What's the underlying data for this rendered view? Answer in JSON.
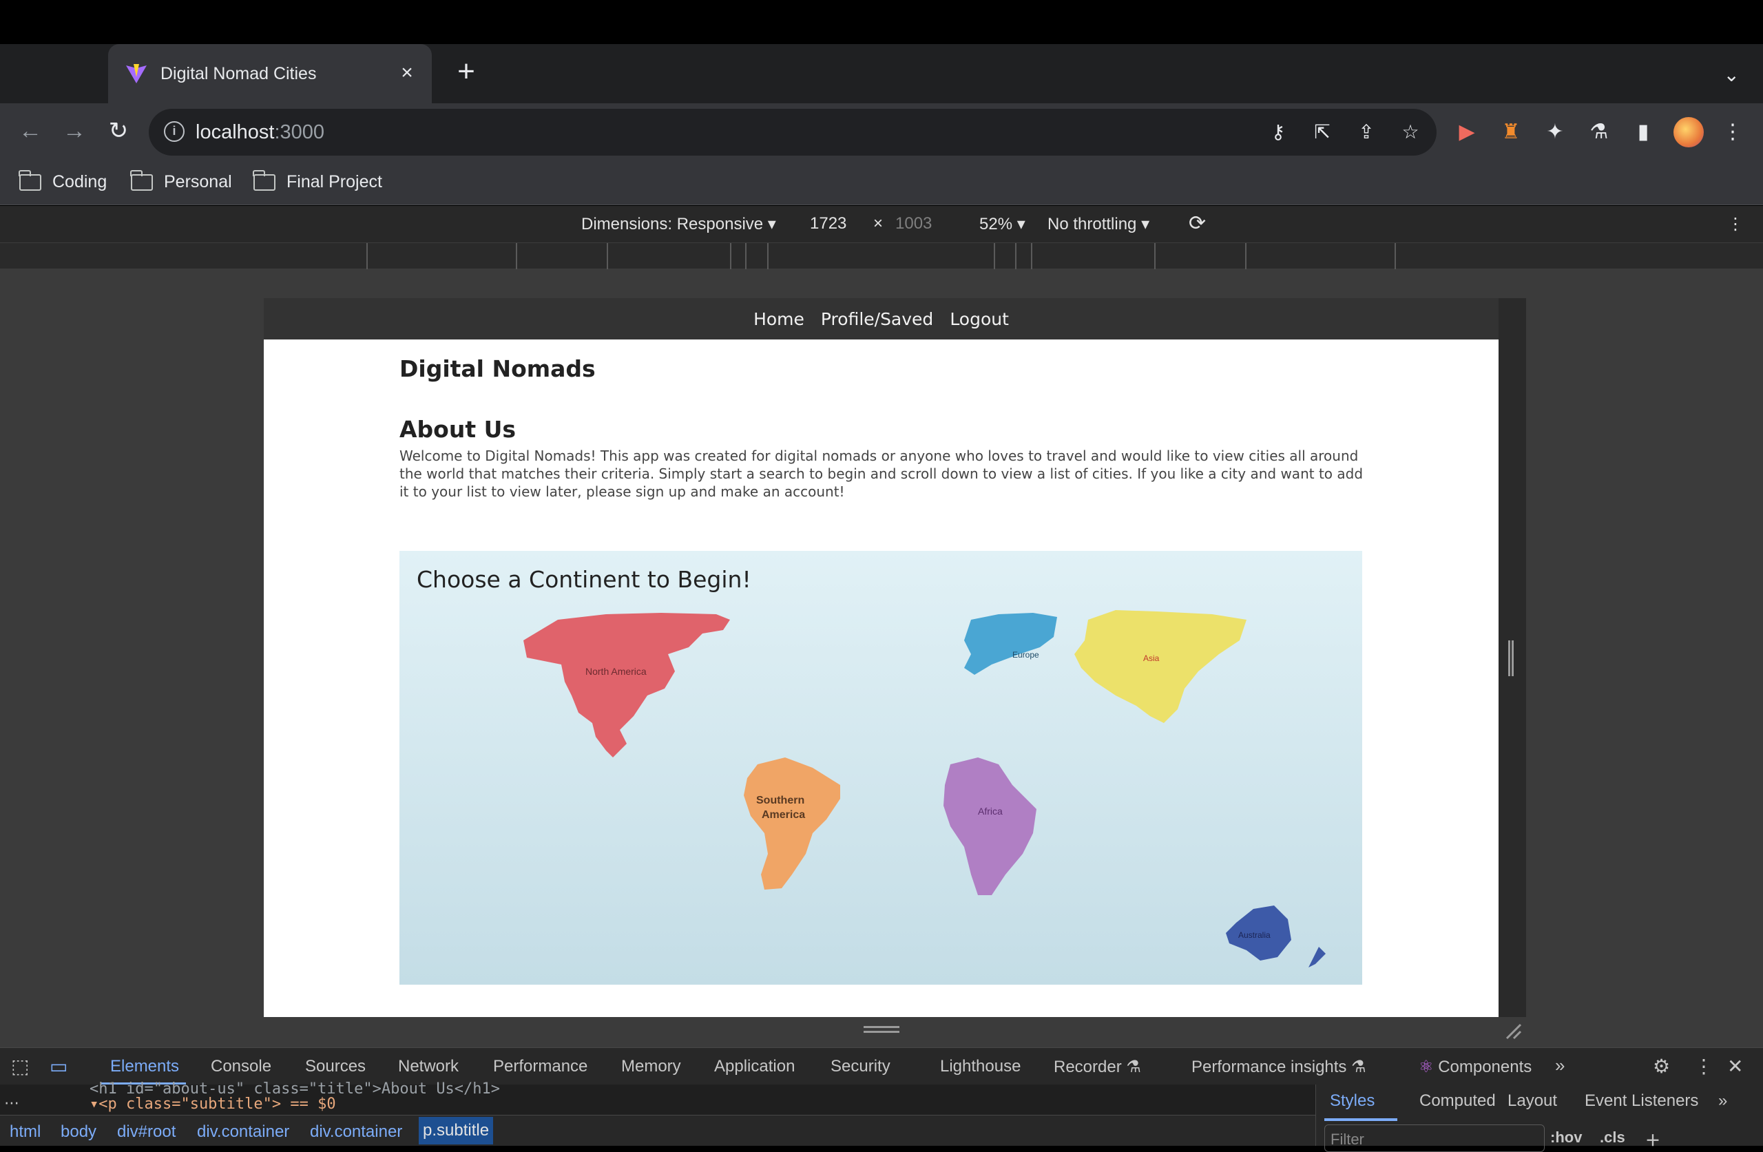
{
  "browser": {
    "tab_title": "Digital Nomad Cities",
    "tab_close": "×",
    "new_tab": "+",
    "url_host": "localhost",
    "url_port": ":3000",
    "bookmarks": [
      "Coding",
      "Personal",
      "Final Project"
    ]
  },
  "device_toolbar": {
    "dimensions_label": "Dimensions: Responsive ▾",
    "width": "1723",
    "times": "×",
    "height": "1003",
    "zoom": "52% ▾",
    "throttling": "No throttling ▾"
  },
  "app": {
    "nav": [
      "Home",
      "Profile/Saved",
      "Logout"
    ],
    "title": "Digital Nomads",
    "about_title": "About Us",
    "about_text": "Welcome to Digital Nomads! This app was created for digital nomads or anyone who loves to travel and would like to view cities all around the world that matches their criteria. Simply start a search to begin and scroll down to view a list of cities. If you like a city and want to add it to your list to view later, please sign up and make an account!",
    "map_title": "Choose a Continent to Begin!",
    "continents": {
      "north_america": "North America",
      "south_america_line1": "Southern",
      "south_america_line2": "America",
      "europe": "Europe",
      "asia": "Asia",
      "africa": "Africa",
      "australia": "Australia"
    },
    "continent_colors": {
      "north_america": "#e0636b",
      "south_america": "#f0a566",
      "europe": "#4aa6d3",
      "asia": "#ece16a",
      "africa": "#b07fc4",
      "australia": "#3d5aa8"
    }
  },
  "devtools": {
    "tabs": [
      "Elements",
      "Console",
      "Sources",
      "Network",
      "Performance",
      "Memory",
      "Application",
      "Security",
      "Lighthouse",
      "Recorder ⚗",
      "Performance insights ⚗",
      "Components"
    ],
    "code_line_1": "<h1 id=\"about-us\" class=\"title\">About Us</h1>",
    "code_line_2": "▾<p class=\"subtitle\"> == $0",
    "breadcrumbs": [
      "html",
      "body",
      "div#root",
      "div.container",
      "div.container",
      "p.subtitle"
    ],
    "side_tabs": [
      "Styles",
      "Computed",
      "Layout",
      "Event Listeners"
    ],
    "filter_placeholder": "Filter",
    "hov": ":hov",
    "cls": ".cls"
  }
}
